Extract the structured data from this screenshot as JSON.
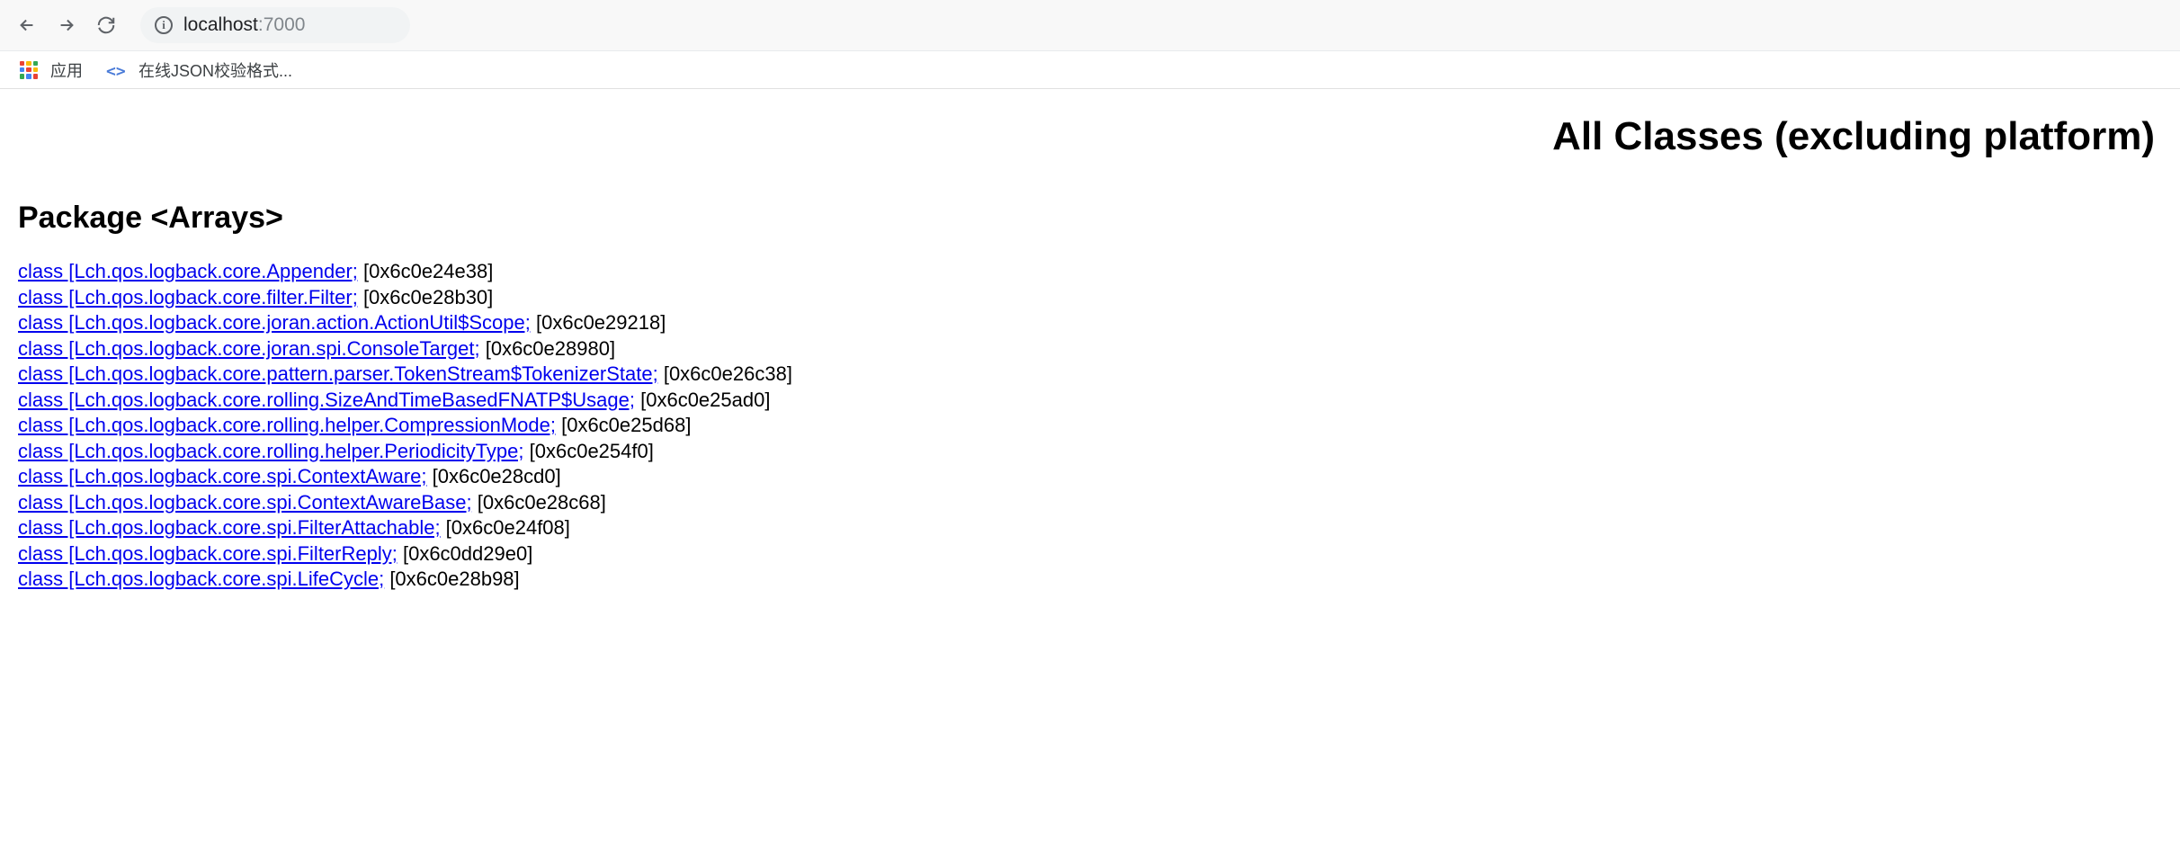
{
  "browser": {
    "url_host": "localhost",
    "url_port": ":7000",
    "bookmarks": {
      "apps_label": "应用",
      "json_bookmark": "在线JSON校验格式..."
    }
  },
  "page": {
    "title": "All Classes (excluding platform)",
    "section_header": "Package <Arrays>"
  },
  "classes": [
    {
      "link": "class [Lch.qos.logback.core.Appender;",
      "hash": " [0x6c0e24e38]"
    },
    {
      "link": "class [Lch.qos.logback.core.filter.Filter;",
      "hash": " [0x6c0e28b30]"
    },
    {
      "link": "class [Lch.qos.logback.core.joran.action.ActionUtil$Scope;",
      "hash": " [0x6c0e29218]"
    },
    {
      "link": "class [Lch.qos.logback.core.joran.spi.ConsoleTarget;",
      "hash": " [0x6c0e28980]"
    },
    {
      "link": "class [Lch.qos.logback.core.pattern.parser.TokenStream$TokenizerState;",
      "hash": " [0x6c0e26c38]"
    },
    {
      "link": "class [Lch.qos.logback.core.rolling.SizeAndTimeBasedFNATP$Usage;",
      "hash": " [0x6c0e25ad0]"
    },
    {
      "link": "class [Lch.qos.logback.core.rolling.helper.CompressionMode;",
      "hash": " [0x6c0e25d68]"
    },
    {
      "link": "class [Lch.qos.logback.core.rolling.helper.PeriodicityType;",
      "hash": " [0x6c0e254f0]"
    },
    {
      "link": "class [Lch.qos.logback.core.spi.ContextAware;",
      "hash": " [0x6c0e28cd0]"
    },
    {
      "link": "class [Lch.qos.logback.core.spi.ContextAwareBase;",
      "hash": " [0x6c0e28c68]"
    },
    {
      "link": "class [Lch.qos.logback.core.spi.FilterAttachable;",
      "hash": " [0x6c0e24f08]"
    },
    {
      "link": "class [Lch.qos.logback.core.spi.FilterReply;",
      "hash": " [0x6c0dd29e0]"
    },
    {
      "link": "class [Lch.qos.logback.core.spi.LifeCycle;",
      "hash": " [0x6c0e28b98]"
    }
  ],
  "apps_colors": [
    "#e94335",
    "#fabb05",
    "#34a853",
    "#4285f4",
    "#e94335",
    "#fabb05",
    "#34a853",
    "#4285f4",
    "#e94335"
  ]
}
